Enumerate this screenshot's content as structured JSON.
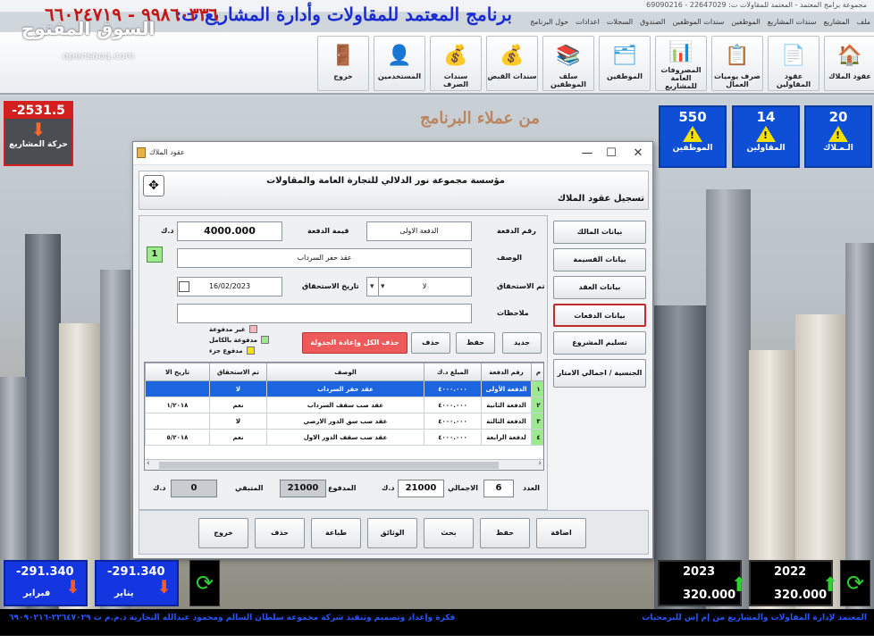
{
  "app": {
    "window_title": "مجموعة برامج المعتمد - المعتمد للمقاولات ت: 22647029 - 69090216",
    "big_title": "برنامج المعتمد للمقاولات وأدارة المشاريع ت:",
    "phone": "٩٩٨٦٠٣٣٦ - ٦٦٠٢٤٧١٩",
    "watermark": "السوق المفتوح",
    "watermark_url": "opensooq.com"
  },
  "menu": [
    "ملف",
    "المشاريع",
    "سندات المشاريع",
    "الموظفين",
    "سندات الموظفين",
    "الصندوق",
    "السجلات",
    "اعدادات",
    "حول البرنامج"
  ],
  "toolbar": [
    {
      "label": "عقود الملاك",
      "icon": "house-icon",
      "glyph": "🏠"
    },
    {
      "label": "عقود المقاولين",
      "icon": "contract-icon",
      "glyph": "📄"
    },
    {
      "label": "صرف يوميات العمال",
      "icon": "checklist-icon",
      "glyph": "📋"
    },
    {
      "label": "المصروفات العامة للمشاريع",
      "icon": "expenses-icon",
      "glyph": "📊"
    },
    {
      "label": "الموظفين",
      "icon": "employees-icon",
      "glyph": "🗂"
    },
    {
      "label": "سلف الموظفين",
      "icon": "binders-icon",
      "glyph": "📚"
    },
    {
      "label": "سندات القبض",
      "icon": "money-in-icon",
      "glyph": "💰"
    },
    {
      "label": "سندات الصرف",
      "icon": "money-out-icon",
      "glyph": "💰"
    },
    {
      "label": "المستخدمين",
      "icon": "user-icon",
      "glyph": "👤"
    },
    {
      "label": "خروج",
      "icon": "door-icon",
      "glyph": "🚪"
    }
  ],
  "desktop": {
    "customers_text": "من عملاء البرنامج"
  },
  "tiles": [
    {
      "value": "20",
      "label": "الـمـلاك"
    },
    {
      "value": "14",
      "label": "المقاولين"
    },
    {
      "value": "550",
      "label": "الموظفين"
    }
  ],
  "projects_tile": {
    "value": "-2531.5",
    "label": "حركة المشاريع"
  },
  "dialog": {
    "title": "عقود الملاك",
    "org": "مؤسسة مجموعة نور الدلالي للتجارة العامة والمقاولات",
    "subtitle": "تسجيل عقود الملاك",
    "nav": [
      "بيانات المالك",
      "بيانات القسيمة",
      "بيانات العقد",
      "بيانات الدفعات",
      "تسليم المشروع",
      "الجنسية / اجمالي الامتار"
    ],
    "form": {
      "payment_no_label": "رقم الدفعة",
      "payment_no_value": "الدفعة الاولى",
      "payment_value_label": "قيمة الدفعة",
      "payment_value": "4000.000",
      "currency": "د.ك",
      "desc_label": "الوصف",
      "desc_value": "عقد حفر السرداب",
      "index_value": "1",
      "due_label": "تم الاستحقاق",
      "due_value": "لا",
      "due_date_label": "تاريخ الاستحقاق",
      "due_date_value": "16/02/2023",
      "notes_label": "ملاحظات",
      "notes_value": ""
    },
    "legend": [
      {
        "label": "غير مدفوعة",
        "color": "#f4b7c0"
      },
      {
        "label": "مدفوعة بالكامل",
        "color": "#9dea8e"
      },
      {
        "label": "مدفوع جزء",
        "color": "#f5e000"
      }
    ],
    "actions": [
      "جديد",
      "حفظ",
      "حذف",
      "حذف الكل وإعادة الجدولة"
    ],
    "grid": {
      "headers": [
        "م",
        "رقم الدفعة",
        "المبلغ د.ك",
        "الوصف",
        "تم الاستحقاق",
        "تاريخ الا"
      ],
      "rows": [
        {
          "n": "١",
          "no": "الدفعة الأولى",
          "amount": "٤٠٠٠.٠٠٠",
          "desc": "عقد حفر السرداب",
          "due": "لا",
          "date": ""
        },
        {
          "n": "٢",
          "no": "الدفعة الثانية",
          "amount": "٤٠٠٠.٠٠٠",
          "desc": "عقد صب سقف السرداب",
          "due": "نعم",
          "date": "١/٢٠١٨"
        },
        {
          "n": "٣",
          "no": "الدفعة الثالثة",
          "amount": "٤٠٠٠.٠٠٠",
          "desc": "عقد صب سق الدور الارضي",
          "due": "لا",
          "date": ""
        },
        {
          "n": "٤",
          "no": "لدفعة الرابعة",
          "amount": "٤٠٠٠.٠٠٠",
          "desc": "عقد صب سقف الدور الاول",
          "due": "نعم",
          "date": "٥/٢٠١٨"
        }
      ]
    },
    "totals": {
      "count_label": "العدد",
      "count": "6",
      "total_label": "الاجمالي",
      "total": "21000",
      "paid_label": "المدفوع",
      "paid": "21000",
      "remaining_label": "المتبقي",
      "remaining": "0",
      "currency": "د.ك"
    },
    "bottom_buttons": [
      "اضافة",
      "حفظ",
      "بحث",
      "الوثائق",
      "طباعة",
      "حذف",
      "خروج"
    ]
  },
  "months": [
    {
      "value": "-291.340",
      "label": "يناير"
    },
    {
      "value": "-291.340",
      "label": "فبراير"
    }
  ],
  "years": [
    {
      "year": "2022",
      "amount": "320.000"
    },
    {
      "year": "2023",
      "amount": "320.000"
    }
  ],
  "marquee": {
    "right": "المعتمد لإدارة المقاولات والمشاريع من إم إس للبرمجيات",
    "left": "فكرة وإعداد وتصميم وتنفيذ شركة مجموعة سلطان السالم ومحمود عبدالله التجارية ذ.م.م ت ٢٢٦٤٧٠٢٩-٦٩٠٩٠٢١٦"
  }
}
